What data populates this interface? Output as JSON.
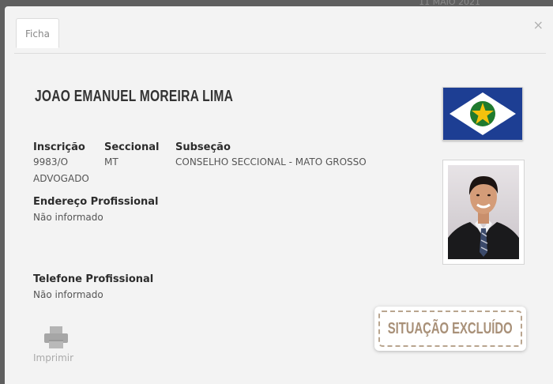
{
  "backdrop": {
    "date_fragment": "11 MAIO 2021"
  },
  "modal": {
    "close_glyph": "×",
    "tab_label": "Ficha",
    "name": "JOAO EMANUEL MOREIRA LIMA",
    "fields": {
      "inscricao_label": "Inscrição",
      "inscricao_value": "9983/O",
      "seccional_label": "Seccional",
      "seccional_value": "MT",
      "subsecao_label": "Subseção",
      "subsecao_value": "CONSELHO SECCIONAL - MATO GROSSO",
      "tipo_value": "ADVOGADO",
      "endereco_label": "Endereço Profissional",
      "endereco_value": "Não informado",
      "telefone_label": "Telefone Profissional",
      "telefone_value": "Não informado"
    },
    "print_label": "Imprimir",
    "status_label": "SITUAÇÃO EXCLUÍDO",
    "icons": {
      "flag": "mato-grosso-flag",
      "print": "printer-icon",
      "close": "close-icon"
    },
    "colors": {
      "flag_blue": "#1d3e93",
      "flag_green": "#1f7a2e",
      "flag_star": "#f4c20d",
      "status_text": "#a89078"
    }
  }
}
